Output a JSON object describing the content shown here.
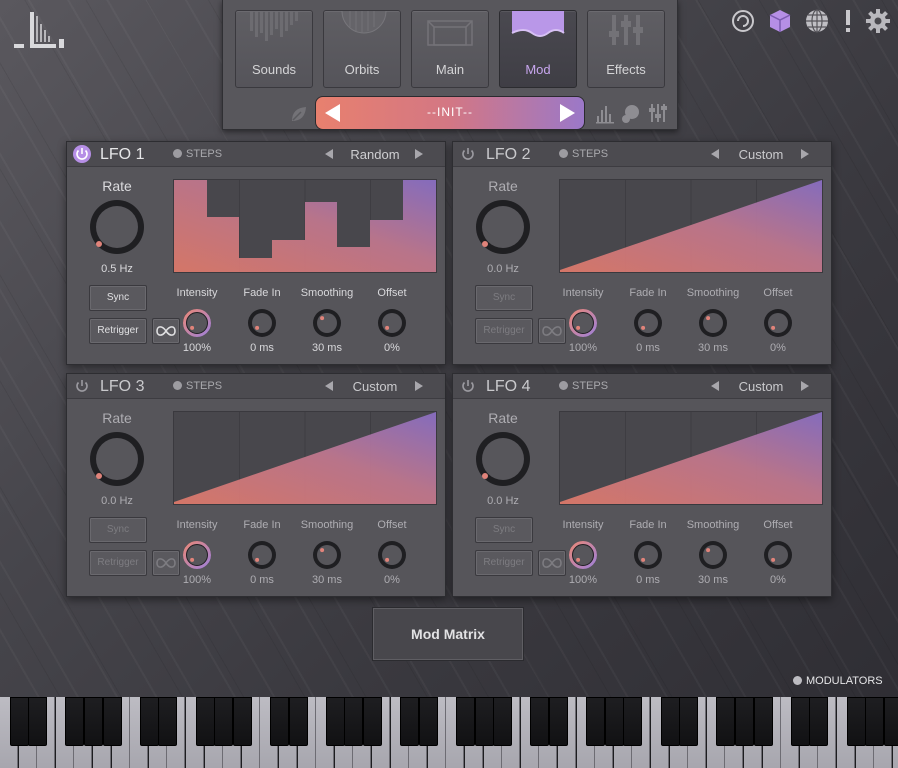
{
  "nav": {
    "tabs": [
      {
        "label": "Sounds",
        "icon": "bars-fringe-icon"
      },
      {
        "label": "Orbits",
        "icon": "orbit-sphere-icon"
      },
      {
        "label": "Main",
        "icon": "main-grid-icon"
      },
      {
        "label": "Mod",
        "icon": "mod-wave-icon",
        "active": true
      },
      {
        "label": "Effects",
        "icon": "sliders-icon"
      }
    ],
    "preset_name": "--INIT--"
  },
  "top_icons": [
    "spiral-icon",
    "cube-icon",
    "globe-icon",
    "alert-icon",
    "gear-icon"
  ],
  "lfos": [
    {
      "title": "LFO 1",
      "steps_label": "STEPS",
      "shape": "Random",
      "rate_label": "Rate",
      "rate": "0.5 Hz",
      "sync_label": "Sync",
      "retrigger_label": "Retrigger",
      "params": [
        {
          "label": "Intensity",
          "value": "100%"
        },
        {
          "label": "Fade In",
          "value": "0 ms"
        },
        {
          "label": "Smoothing",
          "value": "30 ms"
        },
        {
          "label": "Offset",
          "value": "0%"
        }
      ]
    },
    {
      "title": "LFO 2",
      "steps_label": "STEPS",
      "shape": "Custom",
      "rate_label": "Rate",
      "rate": "0.0 Hz",
      "sync_label": "Sync",
      "retrigger_label": "Retrigger",
      "params": [
        {
          "label": "Intensity",
          "value": "100%"
        },
        {
          "label": "Fade In",
          "value": "0 ms"
        },
        {
          "label": "Smoothing",
          "value": "30 ms"
        },
        {
          "label": "Offset",
          "value": "0%"
        }
      ]
    },
    {
      "title": "LFO 3",
      "steps_label": "STEPS",
      "shape": "Custom",
      "rate_label": "Rate",
      "rate": "0.0 Hz",
      "sync_label": "Sync",
      "retrigger_label": "Retrigger",
      "params": [
        {
          "label": "Intensity",
          "value": "100%"
        },
        {
          "label": "Fade In",
          "value": "0 ms"
        },
        {
          "label": "Smoothing",
          "value": "30 ms"
        },
        {
          "label": "Offset",
          "value": "0%"
        }
      ]
    },
    {
      "title": "LFO 4",
      "steps_label": "STEPS",
      "shape": "Custom",
      "rate_label": "Rate",
      "rate": "0.0 Hz",
      "sync_label": "Sync",
      "retrigger_label": "Retrigger",
      "params": [
        {
          "label": "Intensity",
          "value": "100%"
        },
        {
          "label": "Fade In",
          "value": "0 ms"
        },
        {
          "label": "Smoothing",
          "value": "30 ms"
        },
        {
          "label": "Offset",
          "value": "0%"
        }
      ]
    }
  ],
  "mod_matrix_label": "Mod Matrix",
  "modulators_label": "MODULATORS",
  "colors": {
    "accent_purple": "#b68fe6",
    "gradient_start": "#e8806e",
    "gradient_end": "#8e72c9"
  }
}
